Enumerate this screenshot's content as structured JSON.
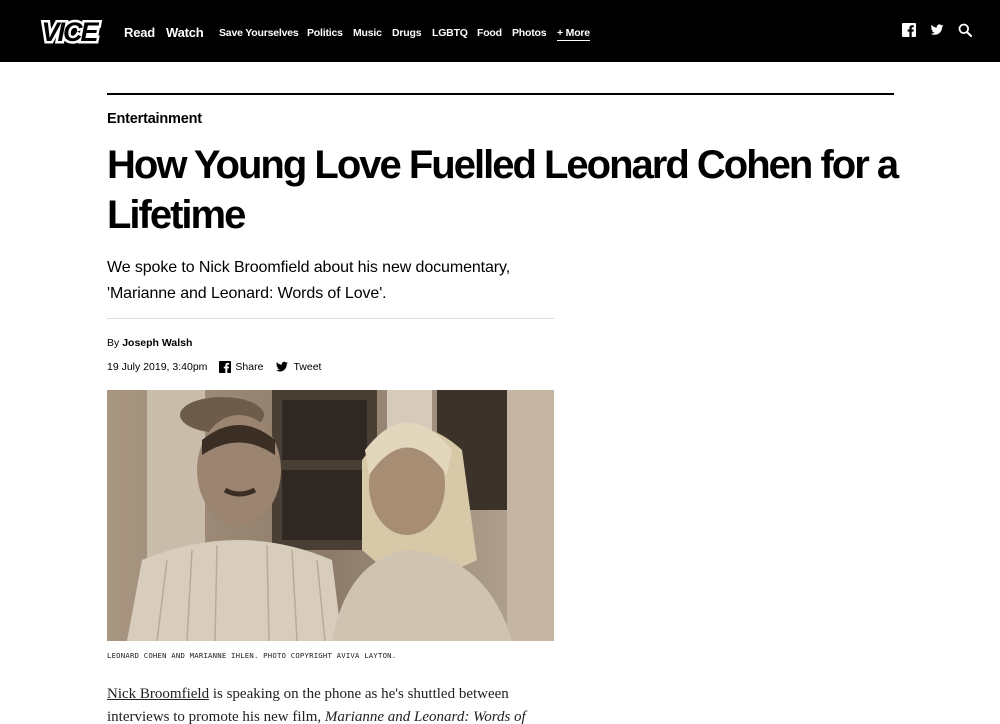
{
  "header": {
    "logo_text": "VICE",
    "nav_primary": [
      "Read",
      "Watch"
    ],
    "nav_secondary": [
      "Save Yourselves",
      "Politics",
      "Music",
      "Drugs",
      "LGBTQ",
      "Food",
      "Photos"
    ],
    "more_label": "+ More",
    "icons": [
      "facebook-icon",
      "twitter-icon",
      "search-icon"
    ]
  },
  "article": {
    "section": "Entertainment",
    "headline": "How Young Love Fuelled Leonard Cohen for a Lifetime",
    "dek": "We spoke to Nick Broomfield about his new documentary, 'Marianne and Leonard: Words of Love'.",
    "byline_prefix": "By",
    "author": "Joseph Walsh",
    "date": "19 July 2019, 3:40pm",
    "share_label": "Share",
    "tweet_label": "Tweet",
    "photo_caption": "LEONARD COHEN AND MARIANNE IHLEN. PHOTO COPYRIGHT AVIVA LAYTON.",
    "body_link": "Nick Broomfield",
    "body_line1_rest": " is speaking on the phone as he's shuttled between",
    "body_line2_start": "interviews to promote his new film, ",
    "body_line2_italic": "Marianne and Leonard: Words of"
  },
  "colors": {
    "header_bg": "#000000",
    "text": "#000000",
    "body_text": "#222222",
    "divider": "#dddddd"
  }
}
